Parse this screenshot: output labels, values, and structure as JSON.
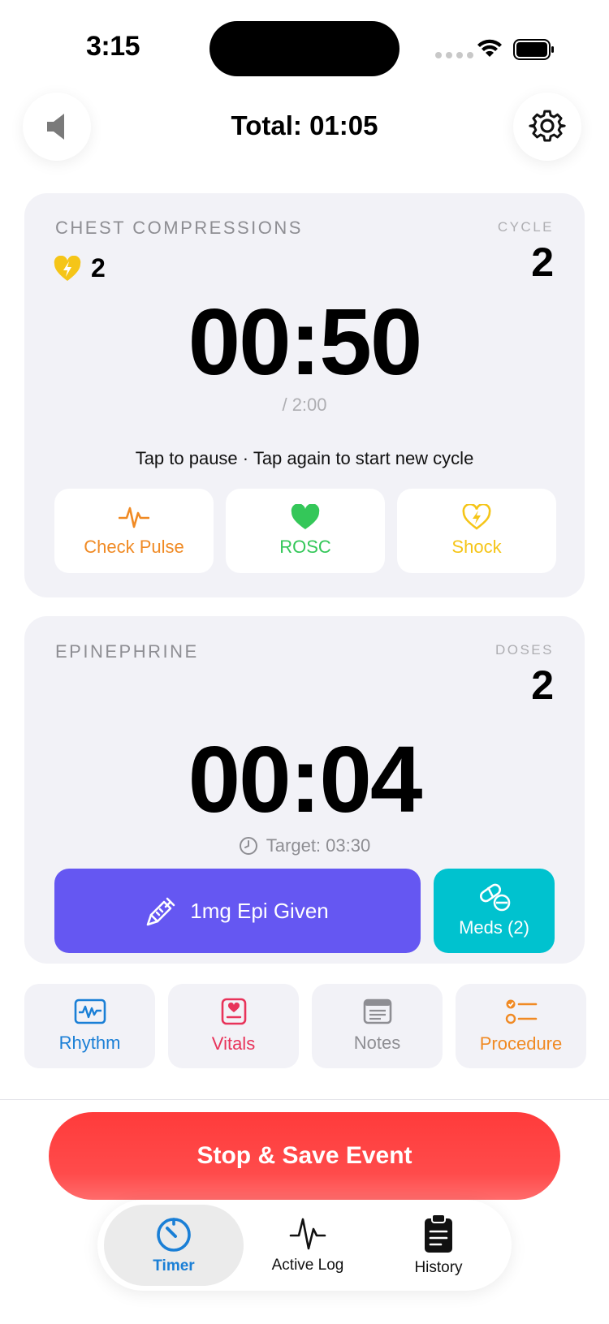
{
  "status_bar": {
    "time": "3:15"
  },
  "header": {
    "total": "Total: 01:05"
  },
  "compressions": {
    "label": "CHEST COMPRESSIONS",
    "shock_count": "2",
    "cycle_label": "CYCLE",
    "cycle_value": "2",
    "timer": "00:50",
    "cycle_length": "/ 2:00",
    "hint": "Tap to pause  ·  Tap again to start new cycle",
    "actions": {
      "check_pulse": "Check Pulse",
      "rosc": "ROSC",
      "shock": "Shock"
    }
  },
  "epinephrine": {
    "label": "EPINEPHRINE",
    "doses_label": "DOSES",
    "doses_value": "2",
    "timer": "00:04",
    "target": "Target: 03:30",
    "epi_button": "1mg Epi Given",
    "meds_button": "Meds (2)"
  },
  "tools": {
    "rhythm": "Rhythm",
    "vitals": "Vitals",
    "notes": "Notes",
    "procedure": "Procedure"
  },
  "stop_button": "Stop & Save Event",
  "tabs": {
    "timer": "Timer",
    "active_log": "Active Log",
    "history": "History"
  },
  "colors": {
    "accent_blue": "#1a7fd6",
    "epi_purple": "#6557f2",
    "meds_teal": "#00c2cf",
    "stop_red": "#ff3b3b",
    "pulse_orange": "#f08a24",
    "rosc_green": "#34c759",
    "shock_yellow": "#f5c518",
    "vitals_pink": "#e8335a"
  }
}
